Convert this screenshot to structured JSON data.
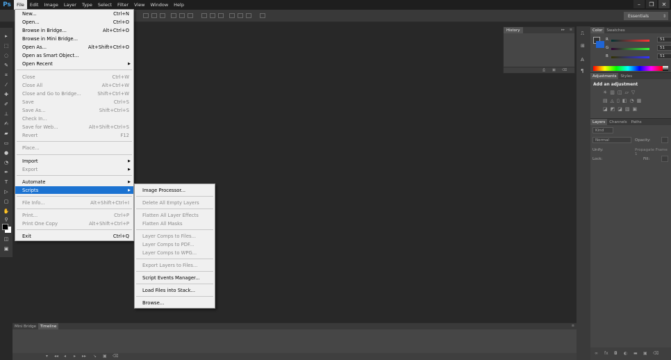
{
  "app": {
    "logo": "Ps"
  },
  "menubar": {
    "items": [
      "File",
      "Edit",
      "Image",
      "Layer",
      "Type",
      "Select",
      "Filter",
      "View",
      "Window",
      "Help"
    ]
  },
  "window_controls": {
    "minimize": "–",
    "restore": "❐",
    "close": "✕"
  },
  "workspace": {
    "label": "Essentials"
  },
  "history_panel": {
    "tab": "History"
  },
  "color_panel": {
    "tabs": [
      "Color",
      "Swatches"
    ],
    "channels": [
      {
        "label": "R",
        "value": "51"
      },
      {
        "label": "G",
        "value": "51"
      },
      {
        "label": "B",
        "value": "51"
      }
    ],
    "foreground": "#333333",
    "background": "#1f65d6"
  },
  "adjustments_panel": {
    "tabs": [
      "Adjustments",
      "Styles"
    ],
    "title": "Add an adjustment"
  },
  "layers_panel": {
    "tabs": [
      "Layers",
      "Channels",
      "Paths"
    ],
    "kind": "Kind",
    "blend_mode": "Normal",
    "opacity_label": "Opacity:",
    "unify_label": "Unify:",
    "propagate_label": "Propagate Frame 1",
    "lock_label": "Lock:",
    "fill_label": "Fill:"
  },
  "bottom_panel": {
    "tabs": [
      "Mini Bridge",
      "Timeline"
    ]
  },
  "file_menu": {
    "items": [
      {
        "label": "New...",
        "shortcut": "Ctrl+N",
        "disabled": false
      },
      {
        "label": "Open...",
        "shortcut": "Ctrl+O",
        "disabled": false
      },
      {
        "label": "Browse in Bridge...",
        "shortcut": "Alt+Ctrl+O",
        "disabled": false
      },
      {
        "label": "Browse in Mini Bridge...",
        "shortcut": "",
        "disabled": false
      },
      {
        "label": "Open As...",
        "shortcut": "Alt+Shift+Ctrl+O",
        "disabled": false
      },
      {
        "label": "Open as Smart Object...",
        "shortcut": "",
        "disabled": false
      },
      {
        "label": "Open Recent",
        "shortcut": "",
        "disabled": false,
        "submenu": true
      },
      {
        "label": "Close",
        "shortcut": "Ctrl+W",
        "disabled": true
      },
      {
        "label": "Close All",
        "shortcut": "Alt+Ctrl+W",
        "disabled": true
      },
      {
        "label": "Close and Go to Bridge...",
        "shortcut": "Shift+Ctrl+W",
        "disabled": true
      },
      {
        "label": "Save",
        "shortcut": "Ctrl+S",
        "disabled": true
      },
      {
        "label": "Save As...",
        "shortcut": "Shift+Ctrl+S",
        "disabled": true
      },
      {
        "label": "Check In...",
        "shortcut": "",
        "disabled": true
      },
      {
        "label": "Save for Web...",
        "shortcut": "Alt+Shift+Ctrl+S",
        "disabled": true
      },
      {
        "label": "Revert",
        "shortcut": "F12",
        "disabled": true
      },
      {
        "label": "Place...",
        "shortcut": "",
        "disabled": true
      },
      {
        "label": "Import",
        "shortcut": "",
        "disabled": false,
        "submenu": true
      },
      {
        "label": "Export",
        "shortcut": "",
        "disabled": true,
        "submenu": true
      },
      {
        "label": "Automate",
        "shortcut": "",
        "disabled": false,
        "submenu": true
      },
      {
        "label": "Scripts",
        "shortcut": "",
        "disabled": false,
        "submenu": true,
        "highlighted": true
      },
      {
        "label": "File Info...",
        "shortcut": "Alt+Shift+Ctrl+I",
        "disabled": true
      },
      {
        "label": "Print...",
        "shortcut": "Ctrl+P",
        "disabled": true
      },
      {
        "label": "Print One Copy",
        "shortcut": "Alt+Shift+Ctrl+P",
        "disabled": true
      },
      {
        "label": "Exit",
        "shortcut": "Ctrl+Q",
        "disabled": false
      }
    ]
  },
  "scripts_menu": {
    "items": [
      {
        "label": "Image Processor...",
        "disabled": false
      },
      {
        "label": "Delete All Empty Layers",
        "disabled": true
      },
      {
        "label": "Flatten All Layer Effects",
        "disabled": true
      },
      {
        "label": "Flatten All Masks",
        "disabled": true
      },
      {
        "label": "Layer Comps to Files...",
        "disabled": true
      },
      {
        "label": "Layer Comps to PDF...",
        "disabled": true
      },
      {
        "label": "Layer Comps to WPG...",
        "disabled": true
      },
      {
        "label": "Export Layers to Files...",
        "disabled": true
      },
      {
        "label": "Script Events Manager...",
        "disabled": false
      },
      {
        "label": "Load Files into Stack...",
        "disabled": false
      },
      {
        "label": "Browse...",
        "disabled": false
      }
    ]
  }
}
